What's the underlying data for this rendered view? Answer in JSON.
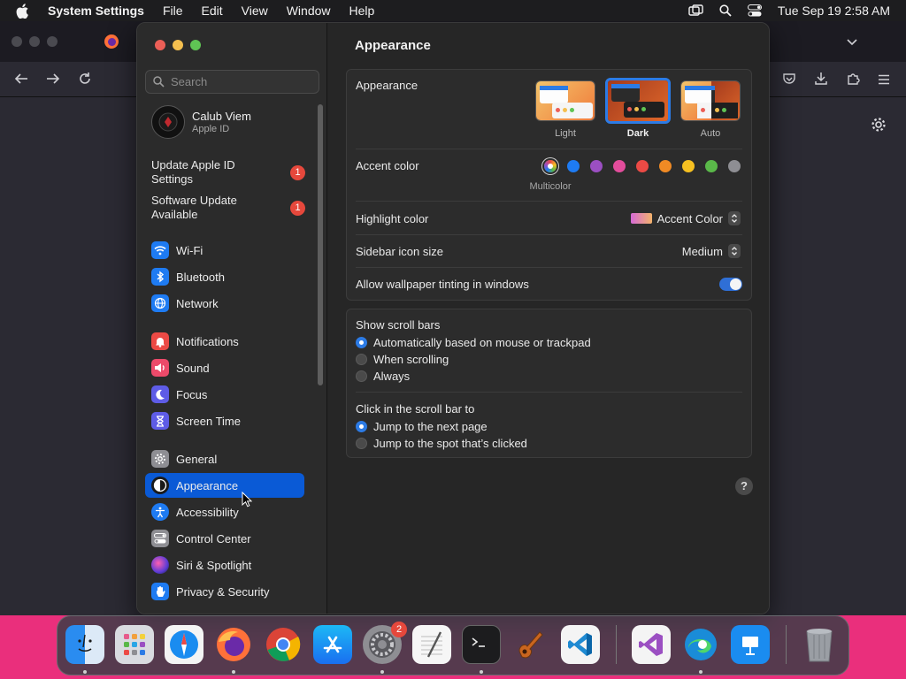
{
  "menubar": {
    "app_name": "System Settings",
    "menus": [
      "File",
      "Edit",
      "View",
      "Window",
      "Help"
    ],
    "clock": "Tue Sep 19  2:58 AM"
  },
  "search": {
    "placeholder": "Search"
  },
  "account": {
    "name": "Calub Viem",
    "subtitle": "Apple ID"
  },
  "notices": [
    {
      "label": "Update Apple ID Settings",
      "badge": "1"
    },
    {
      "label": "Software Update Available",
      "badge": "1"
    }
  ],
  "sidebar": {
    "group1": [
      {
        "label": "Wi-Fi",
        "icon": "wifi-icon",
        "color": "#1e7bf2"
      },
      {
        "label": "Bluetooth",
        "icon": "bluetooth-icon",
        "color": "#1e7bf2"
      },
      {
        "label": "Network",
        "icon": "globe-icon",
        "color": "#1e7bf2"
      }
    ],
    "group2": [
      {
        "label": "Notifications",
        "icon": "bell-icon",
        "color": "#ec4a45"
      },
      {
        "label": "Sound",
        "icon": "speaker-icon",
        "color": "#ec4a6a"
      },
      {
        "label": "Focus",
        "icon": "moon-icon",
        "color": "#5e5ce6"
      },
      {
        "label": "Screen Time",
        "icon": "hourglass-icon",
        "color": "#5e5ce6"
      }
    ],
    "group3": [
      {
        "label": "General",
        "icon": "gear-icon",
        "color": "#8e8e93"
      },
      {
        "label": "Appearance",
        "icon": "appearance-icon",
        "color": "#1a1a1a"
      },
      {
        "label": "Accessibility",
        "icon": "accessibility-icon",
        "color": "#1e7bf2"
      },
      {
        "label": "Control Center",
        "icon": "control-center-icon",
        "color": "#8e8e93"
      },
      {
        "label": "Siri & Spotlight",
        "icon": "siri-icon",
        "color": "#a23bd6"
      },
      {
        "label": "Privacy & Security",
        "icon": "hand-icon",
        "color": "#1e7bf2"
      }
    ],
    "selected": "Appearance"
  },
  "main": {
    "title": "Appearance",
    "appearance_label": "Appearance",
    "themes": [
      {
        "label": "Light",
        "selected": false
      },
      {
        "label": "Dark",
        "selected": true
      },
      {
        "label": "Auto",
        "selected": false
      }
    ],
    "accent_label": "Accent color",
    "accent_selected_name": "Multicolor",
    "accent_colors": [
      "#1e7bf2",
      "#9b4fc2",
      "#e34d9c",
      "#eb4a45",
      "#f08a24",
      "#f6c021",
      "#5ab849",
      "#8e8e93"
    ],
    "highlight_label": "Highlight color",
    "highlight_value": "Accent Color",
    "icon_size_label": "Sidebar icon size",
    "icon_size_value": "Medium",
    "tinting_label": "Allow wallpaper tinting in windows",
    "tinting_on": true,
    "scrollbars_label": "Show scroll bars",
    "scrollbars_options": [
      {
        "label": "Automatically based on mouse or trackpad",
        "selected": true
      },
      {
        "label": "When scrolling",
        "selected": false
      },
      {
        "label": "Always",
        "selected": false
      }
    ],
    "click_label": "Click in the scroll bar to",
    "click_options": [
      {
        "label": "Jump to the next page",
        "selected": true
      },
      {
        "label": "Jump to the spot that’s clicked",
        "selected": false
      }
    ],
    "help": "?"
  },
  "dock": {
    "apps": [
      "finder",
      "launchpad",
      "safari",
      "firefox",
      "chrome",
      "app-store",
      "system-settings",
      "textedit",
      "terminal",
      "garageband",
      "vscode",
      "visual-studio",
      "edge",
      "keynote",
      "trash"
    ],
    "settings_badge": "2"
  },
  "colors": {
    "accent": "#0a5ad6",
    "badge": "#e6483c",
    "desktop": "#ea2f7c"
  }
}
